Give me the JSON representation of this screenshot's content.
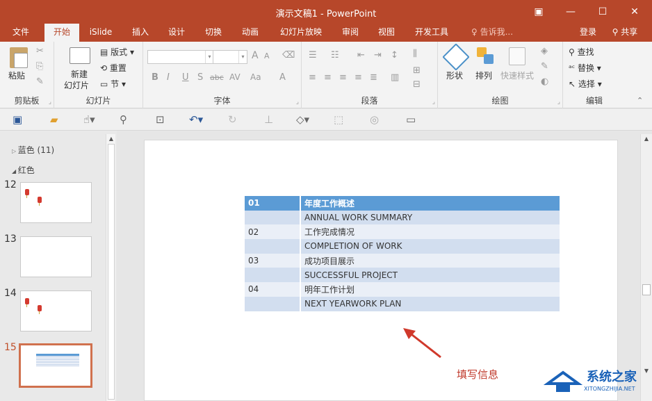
{
  "window": {
    "title": "演示文稿1 - PowerPoint",
    "minimize": "—",
    "maximize": "☐",
    "close": "✕",
    "ribbon_toggle": "▣"
  },
  "tabs": [
    "文件",
    "开始",
    "iSlide",
    "插入",
    "设计",
    "切换",
    "动画",
    "幻灯片放映",
    "审阅",
    "视图",
    "开发工具"
  ],
  "tell_me": "告诉我...",
  "login": "登录",
  "share": "共享",
  "ribbon": {
    "clipboard": {
      "paste": "粘贴",
      "label": "剪贴板"
    },
    "slides": {
      "new_slide_line1": "新建",
      "new_slide_line2": "幻灯片",
      "layout": "版式",
      "reset": "重置",
      "section": "节",
      "label": "幻灯片"
    },
    "font": {
      "label": "字体",
      "grow": "A",
      "shrink": "A",
      "bold": "B",
      "italic": "I",
      "underline": "U",
      "shadow": "S",
      "strike": "abc",
      "spacing": "AV",
      "case": "Aa",
      "color": "A"
    },
    "paragraph": {
      "label": "段落"
    },
    "drawing": {
      "shape": "形状",
      "arrange": "排列",
      "quick_style": "快速样式",
      "label": "绘图"
    },
    "editing": {
      "find": "查找",
      "replace": "替换",
      "select": "选择",
      "label": "编辑"
    }
  },
  "panel": {
    "section_blue": "蓝色 (11)",
    "section_red": "红色",
    "slide_numbers": [
      "12",
      "13",
      "14",
      "15"
    ]
  },
  "table": {
    "rows": [
      {
        "c1": "01",
        "c2": "年度工作概述",
        "style": "hdr"
      },
      {
        "c1": "",
        "c2": "ANNUAL WORK SUMMARY",
        "style": "dark"
      },
      {
        "c1": "02",
        "c2": "工作完成情况",
        "style": "light"
      },
      {
        "c1": "",
        "c2": "COMPLETION OF WORK",
        "style": "dark"
      },
      {
        "c1": "03",
        "c2": "成功项目展示",
        "style": "light"
      },
      {
        "c1": "",
        "c2": "SUCCESSFUL PROJECT",
        "style": "dark"
      },
      {
        "c1": "04",
        "c2": "明年工作计划",
        "style": "light"
      },
      {
        "c1": "",
        "c2": "NEXT YEARWORK PLAN",
        "style": "dark"
      }
    ]
  },
  "annotation": "填写信息",
  "watermark": {
    "name": "系统之家",
    "url": "XITONGZHIJIA.NET"
  },
  "colors": {
    "accent": "#b7472a",
    "table_header": "#5b9bd5",
    "table_dark": "#d2deef",
    "table_light": "#eaeff7",
    "annotation": "#c0392b"
  }
}
